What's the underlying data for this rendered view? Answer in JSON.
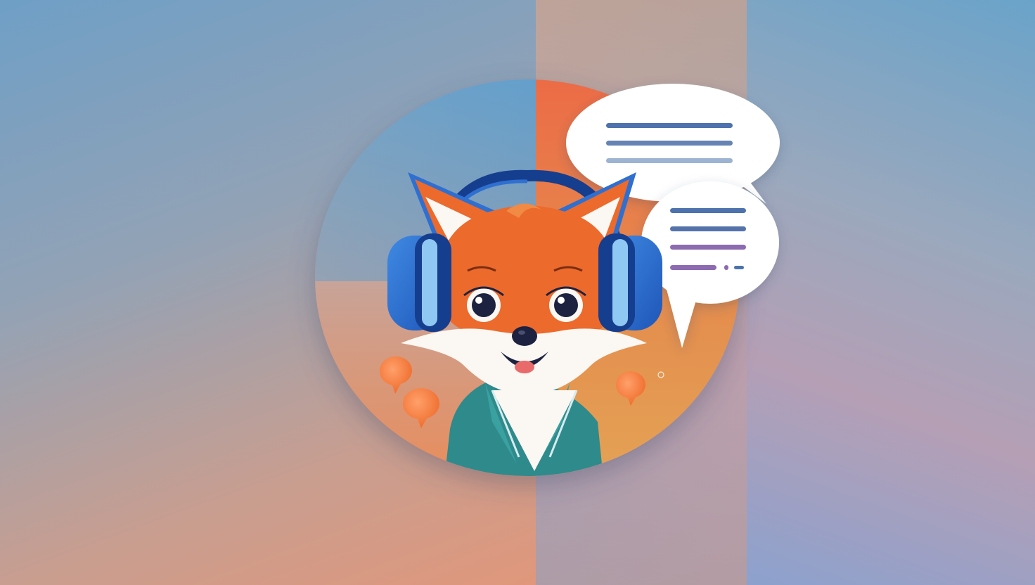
{
  "scene": {
    "subject": "fox-with-headphones-icon",
    "colors": {
      "bg_left_top": "#6f9fc6",
      "bg_left_bottom": "#e0977b",
      "bg_right_top": "#6aa3c9",
      "bg_right_bottom": "#7ea2d6",
      "fox_orange": "#ec6a2c",
      "fox_white": "#fbf7f2",
      "headphone_blue": "#2f6fd0",
      "headphone_dark": "#163e8f",
      "jacket_teal": "#2f8a8c",
      "bubble_white": "#ffffff",
      "line_blue": "#4d72ad",
      "line_purple": "#8d6bb0",
      "small_bubble_orange": "#f07a3a"
    }
  }
}
